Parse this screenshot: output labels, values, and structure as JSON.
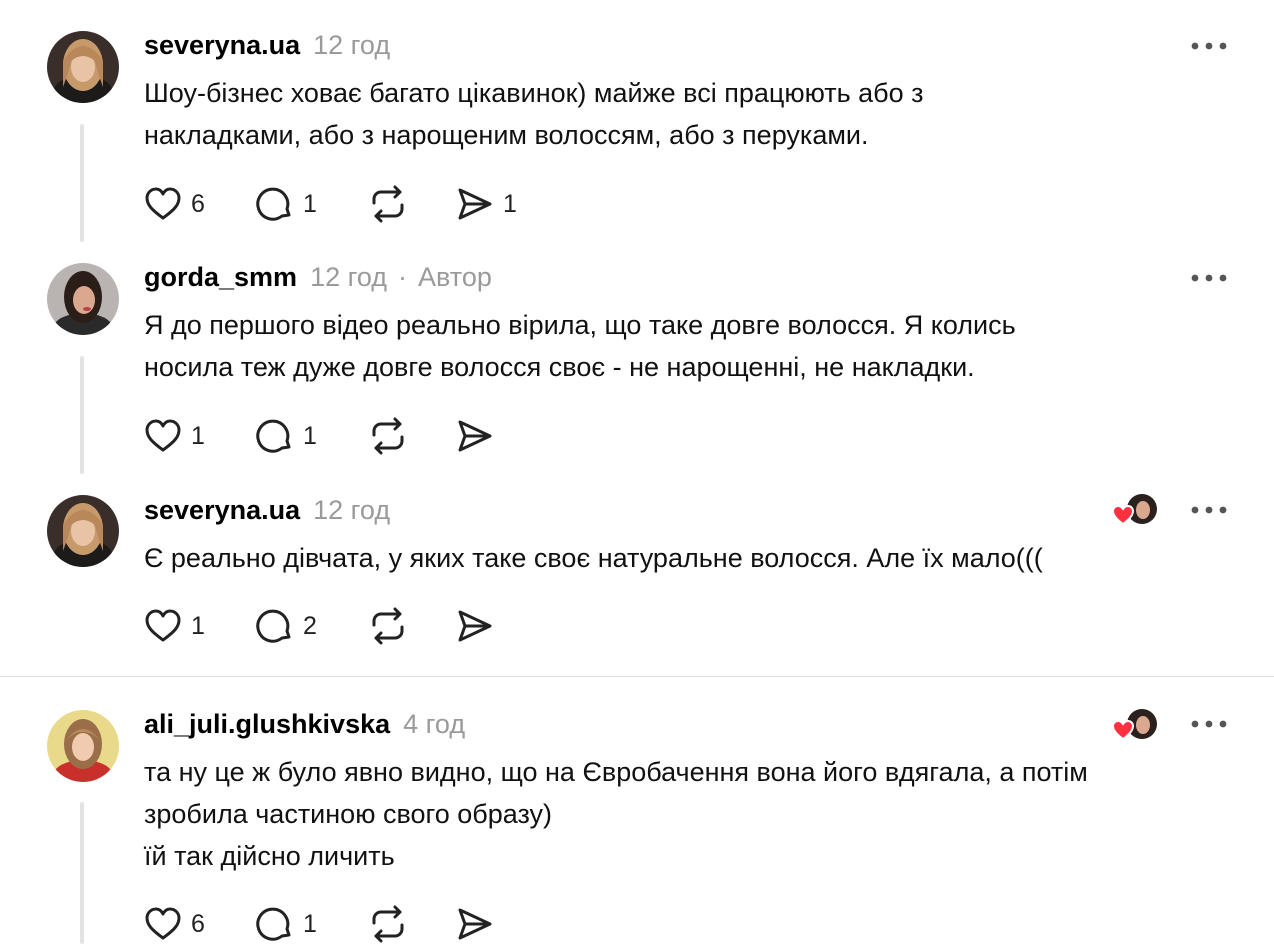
{
  "posts": [
    {
      "username": "severyna.ua",
      "time": "12 год",
      "author_label": "",
      "text_lines": [
        "Шоу-бізнес ховає багато цікавинок) майже всі працюють або з",
        "накладками, або з нарощеним волоссям, або з перуками."
      ],
      "likes": "6",
      "replies": "1",
      "reposts": "",
      "shares": "1",
      "liked_by_author": false
    },
    {
      "username": "gorda_smm",
      "time": "12 год",
      "author_label": "Автор",
      "separator": "·",
      "text_lines": [
        "Я до першого відео реально вірила, що таке довге волосся. Я колись",
        "носила теж дуже довге волосся своє - не нарощенні, не накладки."
      ],
      "likes": "1",
      "replies": "1",
      "reposts": "",
      "shares": "",
      "liked_by_author": false
    },
    {
      "username": "severyna.ua",
      "time": "12 год",
      "author_label": "",
      "text_lines": [
        "Є реально дівчата, у яких таке своє натуральне волосся. Але їх мало((("
      ],
      "likes": "1",
      "replies": "2",
      "reposts": "",
      "shares": "",
      "liked_by_author": true
    },
    {
      "username": "ali_juli.glushkivska",
      "time": "4 год",
      "author_label": "",
      "text_lines": [
        "та ну це ж було явно видно, що на Євробачення вона його вдягала, а потім",
        "зробила частиною свого образу)",
        "їй так дійсно личить"
      ],
      "likes": "6",
      "replies": "1",
      "reposts": "",
      "shares": "",
      "liked_by_author": true
    }
  ],
  "icons": {
    "like": "heart-icon",
    "reply": "comment-icon",
    "repost": "repost-icon",
    "share": "share-icon",
    "more": "more-icon"
  },
  "colors": {
    "text": "#000000",
    "muted": "#9a9a9a",
    "heart_red": "#ff3040",
    "thread_line": "#e3e3e3",
    "divider": "#dcdcdc"
  }
}
